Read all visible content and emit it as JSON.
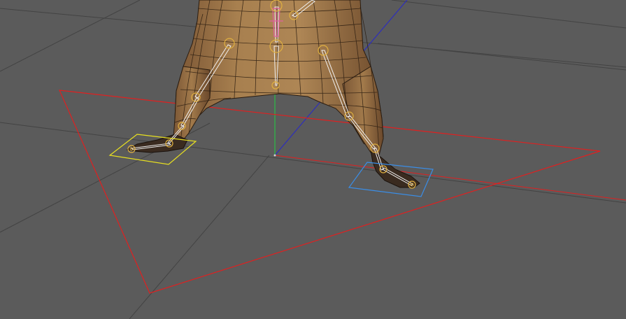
{
  "app": {
    "panel": "3D viewport",
    "projection": "perspective",
    "background_color": "#5b5b5b"
  },
  "scene": {
    "model": "character-lower-body",
    "display": "wireframe-on-shaded",
    "mesh_color": "#a47a4e",
    "mesh_shadow_color": "#6e4e30",
    "foot_color": "#3a2b20",
    "grid_color": "#3f3f3f",
    "axis_colors": {
      "x": "#c0392b",
      "y": "#2ecc40",
      "z": "#2b2bd0"
    },
    "joint_color": "#e0b040",
    "bone_color": "#ffffff",
    "root_joint_color": "#e060a0",
    "selection_colors": {
      "ground_triangle": "#e02020",
      "left_foot_control": "#e8e020",
      "right_foot_control": "#3a8ee8"
    },
    "objects": [
      "ground-triangle-control",
      "left-foot-ik-control",
      "right-foot-ik-control",
      "spine-root-joint"
    ]
  }
}
